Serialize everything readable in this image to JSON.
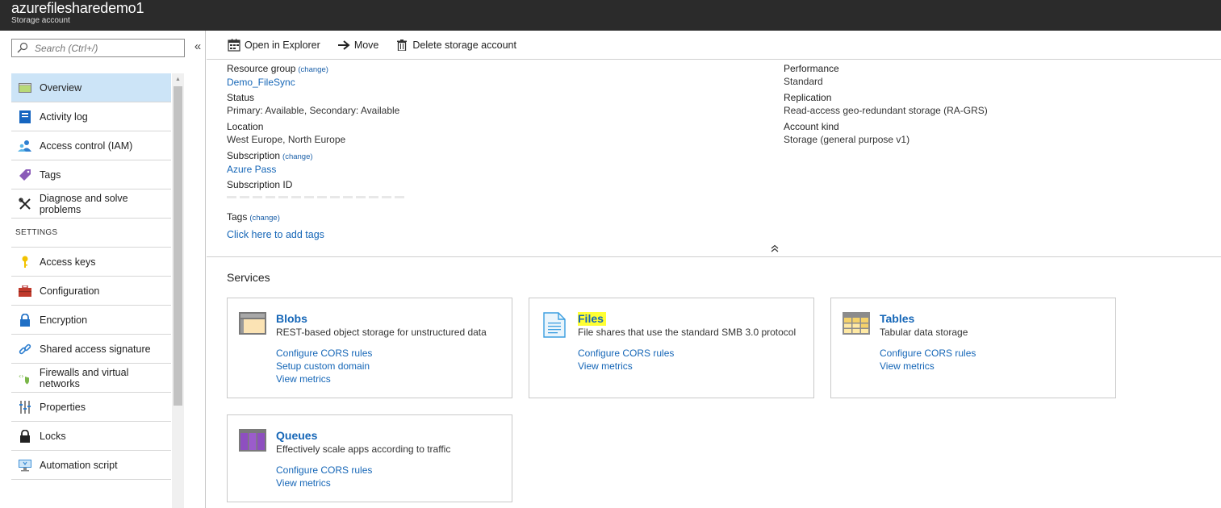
{
  "header": {
    "title": "azurefilesharedemo1",
    "subtitle": "Storage account"
  },
  "sidebar": {
    "search_placeholder": "Search (Ctrl+/)",
    "collapse_glyph": "«",
    "items": [
      {
        "label": "Overview",
        "icon": "overview-icon",
        "selected": true
      },
      {
        "label": "Activity log",
        "icon": "activity-log-icon"
      },
      {
        "label": "Access control (IAM)",
        "icon": "access-control-icon"
      },
      {
        "label": "Tags",
        "icon": "tag-icon"
      },
      {
        "label": "Diagnose and solve problems",
        "icon": "wrench-icon"
      }
    ],
    "settings_label": "SETTINGS",
    "settings_items": [
      {
        "label": "Access keys",
        "icon": "key-icon"
      },
      {
        "label": "Configuration",
        "icon": "briefcase-icon"
      },
      {
        "label": "Encryption",
        "icon": "lock-icon"
      },
      {
        "label": "Shared access signature",
        "icon": "link-icon"
      },
      {
        "label": "Firewalls and virtual networks",
        "icon": "firewall-icon"
      },
      {
        "label": "Properties",
        "icon": "properties-icon"
      },
      {
        "label": "Locks",
        "icon": "padlock-icon"
      },
      {
        "label": "Automation script",
        "icon": "automation-icon"
      }
    ]
  },
  "toolbar": {
    "open_explorer": "Open in Explorer",
    "move": "Move",
    "delete": "Delete storage account"
  },
  "essentials": {
    "change_label": "(change)",
    "resource_group_label": "Resource group",
    "resource_group_value": "Demo_FileSync",
    "status_label": "Status",
    "status_value": "Primary: Available, Secondary: Available",
    "location_label": "Location",
    "location_value": "West Europe, North Europe",
    "subscription_label": "Subscription",
    "subscription_value": "Azure Pass",
    "subscription_id_label": "Subscription ID",
    "performance_label": "Performance",
    "performance_value": "Standard",
    "replication_label": "Replication",
    "replication_value": "Read-access geo-redundant storage (RA-GRS)",
    "account_kind_label": "Account kind",
    "account_kind_value": "Storage (general purpose v1)",
    "tags_label": "Tags",
    "tags_value": "Click here to add tags",
    "collapse_glyph": "⌃"
  },
  "services": {
    "title": "Services",
    "cards": [
      {
        "title": "Blobs",
        "desc": "REST-based object storage for unstructured data",
        "links": [
          "Configure CORS rules",
          "Setup custom domain",
          "View metrics"
        ]
      },
      {
        "title": "Files",
        "desc": "File shares that use the standard SMB 3.0 protocol",
        "links": [
          "Configure CORS rules",
          "View metrics"
        ]
      },
      {
        "title": "Tables",
        "desc": "Tabular data storage",
        "links": [
          "Configure CORS rules",
          "View metrics"
        ]
      },
      {
        "title": "Queues",
        "desc": "Effectively scale apps according to traffic",
        "links": [
          "Configure CORS rules",
          "View metrics"
        ]
      }
    ]
  },
  "colors": {
    "header_bg": "#2b2b2b",
    "selected_bg": "#cce4f7",
    "link": "#1566b7",
    "highlight": "#ffff33"
  }
}
